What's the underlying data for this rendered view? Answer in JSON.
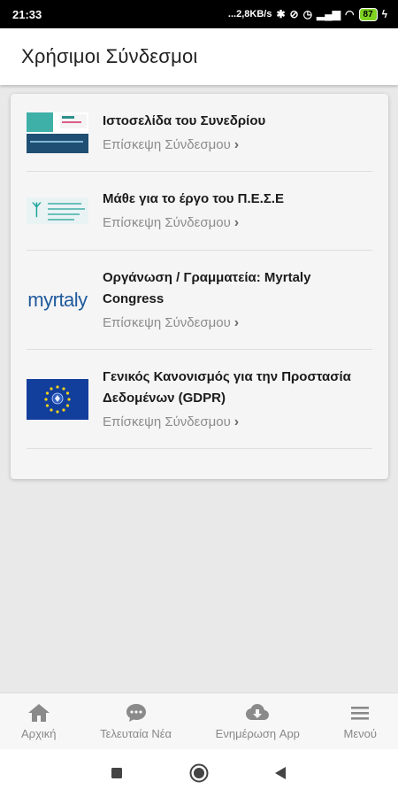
{
  "status_bar": {
    "time": "21:33",
    "net_speed": "...2,8KB/s",
    "battery": "87"
  },
  "header": {
    "title": "Χρήσιμοι Σύνδεσμοι"
  },
  "links": [
    {
      "title": "Ιστοσελίδα του Συνεδρίου",
      "link_label": "Επίσκεψη Σύνδεσμου",
      "thumb": "conference-banner"
    },
    {
      "title": "Μάθε για το έργο του Π.Ε.Σ.Ε",
      "link_label": "Επίσκεψη Σύνδεσμου",
      "thumb": "pese-logo"
    },
    {
      "title": "Οργάνωση / Γραμματεία: Myrtaly Congress",
      "link_label": "Επίσκεψη Σύνδεσμου",
      "thumb": "myrtaly-logo",
      "logo_text": "myrtaly"
    },
    {
      "title": "Γενικός Κανονισμός για την Προστασία Δεδομένων (GDPR)",
      "link_label": "Επίσκεψη Σύνδεσμου",
      "thumb": "eu-gdpr-flag"
    }
  ],
  "bottom_nav": [
    {
      "label": "Αρχική",
      "icon": "home-icon"
    },
    {
      "label": "Τελευταία Νέα",
      "icon": "chat-icon"
    },
    {
      "label": "Ενημέρωση App",
      "icon": "cloud-download-icon"
    },
    {
      "label": "Μενού",
      "icon": "menu-icon"
    }
  ],
  "colors": {
    "accent_icon": "#8a8a8a",
    "gdpr_blue": "#123f9c",
    "myrtaly_blue": "#1f5a9c"
  }
}
